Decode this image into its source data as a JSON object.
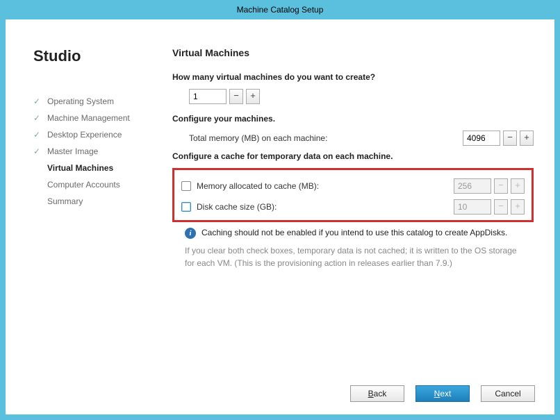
{
  "window": {
    "title": "Machine Catalog Setup"
  },
  "sidebar": {
    "title": "Studio",
    "items": [
      {
        "label": "Operating System",
        "state": "completed"
      },
      {
        "label": "Machine Management",
        "state": "completed"
      },
      {
        "label": "Desktop Experience",
        "state": "completed"
      },
      {
        "label": "Master Image",
        "state": "completed"
      },
      {
        "label": "Virtual Machines",
        "state": "current"
      },
      {
        "label": "Computer Accounts",
        "state": "upcoming"
      },
      {
        "label": "Summary",
        "state": "upcoming"
      }
    ]
  },
  "main": {
    "page_title": "Virtual Machines",
    "vm_count": {
      "question": "How many virtual machines do you want to create?",
      "value": "1"
    },
    "configure_label": "Configure your machines.",
    "memory": {
      "label": "Total memory (MB) on each machine:",
      "value": "4096"
    },
    "cache_section_label": "Configure a cache for temporary data on each machine.",
    "cache_memory": {
      "checkbox_label": "Memory allocated to cache (MB):",
      "value": "256",
      "checked": false,
      "enabled": false
    },
    "cache_disk": {
      "checkbox_label": "Disk cache size (GB):",
      "value": "10",
      "checked": false,
      "enabled": false
    },
    "info_text": "Caching should not be enabled if you intend to use this catalog to create AppDisks.",
    "hint_text": "If you clear both check boxes, temporary data is not cached; it is written to the OS storage for each VM. (This is the provisioning action in releases earlier than 7.9.)"
  },
  "buttons": {
    "back": "Back",
    "next": "Next",
    "cancel": "Cancel"
  }
}
